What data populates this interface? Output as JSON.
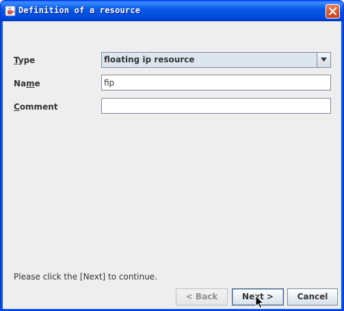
{
  "window": {
    "title": "Definition of a resource",
    "close_icon": "close-icon",
    "app_icon": "java-cup-icon"
  },
  "form": {
    "type_label": "Type",
    "type_mnemonic": "T",
    "type_value": "floating ip resource",
    "name_label": "Name",
    "name_mnemonic": "m",
    "name_value": "fip",
    "comment_label": "Comment",
    "comment_mnemonic": "C",
    "comment_value": ""
  },
  "footer": {
    "hint": "Please click the [Next] to continue.",
    "back_label": "< Back",
    "back_enabled": false,
    "next_label": "Next >",
    "cancel_label": "Cancel"
  },
  "colors": {
    "titlebar": "#0055e5",
    "client_bg": "#eeeeee",
    "close_button": "#e0592f"
  }
}
